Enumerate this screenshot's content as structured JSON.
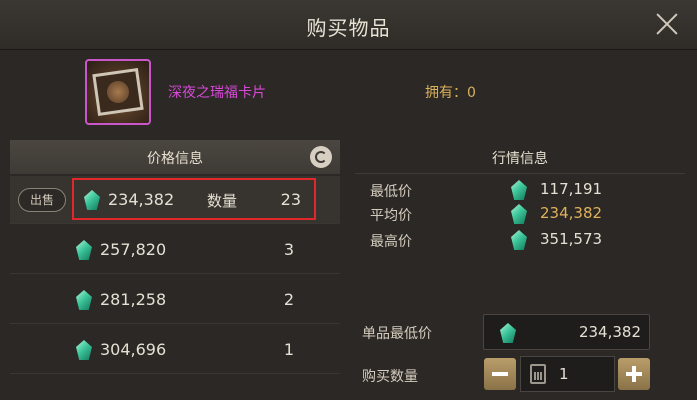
{
  "window": {
    "title": "购买物品",
    "close_icon": "close-icon"
  },
  "item": {
    "name": "深夜之瑞福卡片",
    "owned_label": "拥有：0"
  },
  "price_panel": {
    "title": "价格信息",
    "refresh_icon": "refresh-icon",
    "sell_label": "出售",
    "qty_label": "数量",
    "listings": [
      {
        "price": "234,382",
        "qty": "23"
      },
      {
        "price": "257,820",
        "qty": "3"
      },
      {
        "price": "281,258",
        "qty": "2"
      },
      {
        "price": "304,696",
        "qty": "1"
      }
    ]
  },
  "market": {
    "title": "行情信息",
    "rows": [
      {
        "label": "最低价",
        "value": "117,191"
      },
      {
        "label": "平均价",
        "value": "234,382"
      },
      {
        "label": "最高价",
        "value": "351,573"
      }
    ]
  },
  "purchase": {
    "unit_price_label": "单品最低价",
    "unit_price": "234,382",
    "qty_label": "购买数量",
    "qty_value": "1"
  },
  "colors": {
    "rarity": "#d64ad6",
    "gold": "#e1b15c",
    "highlight": "#e1272b",
    "gem": "#3ec69c"
  }
}
